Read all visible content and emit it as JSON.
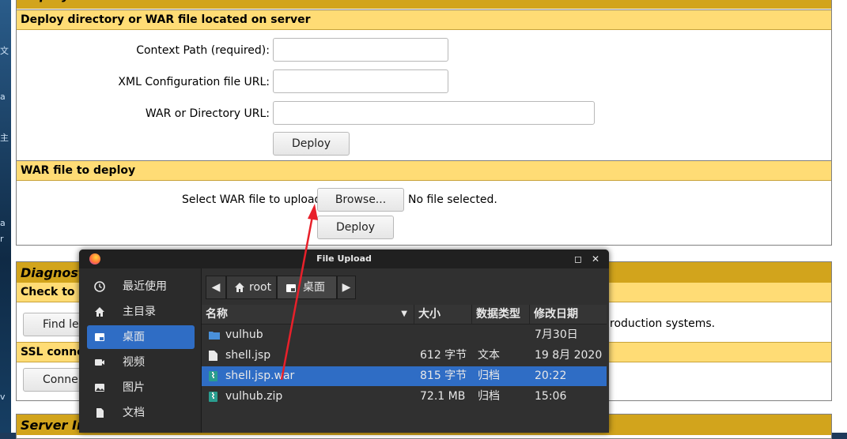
{
  "deploy_section": {
    "top_header": "Deploy",
    "header": "Deploy directory or WAR file located on server",
    "context_path_label": "Context Path (required):",
    "xml_config_label": "XML Configuration file URL:",
    "war_dir_label": "WAR or Directory URL:",
    "deploy_button": "Deploy"
  },
  "war_section": {
    "header": "WAR file to deploy",
    "select_label": "Select WAR file to upload",
    "browse_button": "Browse...",
    "no_file_text": "No file selected.",
    "deploy_button": "Deploy"
  },
  "diagnostics": {
    "header": "Diagnost",
    "check_header": "Check to s",
    "find_button": "Find lea",
    "find_desc": "roduction systems.",
    "ssl_header": "SSL conne",
    "connect_button": "Conne"
  },
  "server_info": {
    "header": "Server In"
  },
  "bg_chars": [
    "文",
    "a",
    "主",
    "a",
    "r",
    "v"
  ],
  "dialog": {
    "title": "File Upload",
    "sidebar": [
      {
        "label": "最近使用",
        "icon": "recent-icon"
      },
      {
        "label": "主目录",
        "icon": "home-icon"
      },
      {
        "label": "桌面",
        "icon": "desktop-icon",
        "selected": true
      },
      {
        "label": "视频",
        "icon": "video-icon"
      },
      {
        "label": "图片",
        "icon": "picture-icon"
      },
      {
        "label": "文档",
        "icon": "document-icon"
      }
    ],
    "path": [
      "root",
      "桌面"
    ],
    "columns": [
      "名称",
      "大小",
      "数据类型",
      "修改日期"
    ],
    "files": [
      {
        "name": "vulhub",
        "size": "",
        "type": "",
        "modified": "7月30日",
        "icon": "folder-icon"
      },
      {
        "name": "shell.jsp",
        "size": "612 字节",
        "type": "文本",
        "modified": "19 8月 2020",
        "icon": "text-file-icon"
      },
      {
        "name": "shell.jsp.war",
        "size": "815 字节",
        "type": "归档",
        "modified": "20:22",
        "icon": "archive-icon",
        "selected": true
      },
      {
        "name": "vulhub.zip",
        "size": "72.1 MB",
        "type": "归档",
        "modified": "15:06",
        "icon": "archive-icon"
      }
    ]
  },
  "colors": {
    "section_header": "#ffdc75",
    "gold_header": "#d2a41c",
    "selection": "#2f6dc5",
    "annotation_arrow": "#e8202a"
  }
}
